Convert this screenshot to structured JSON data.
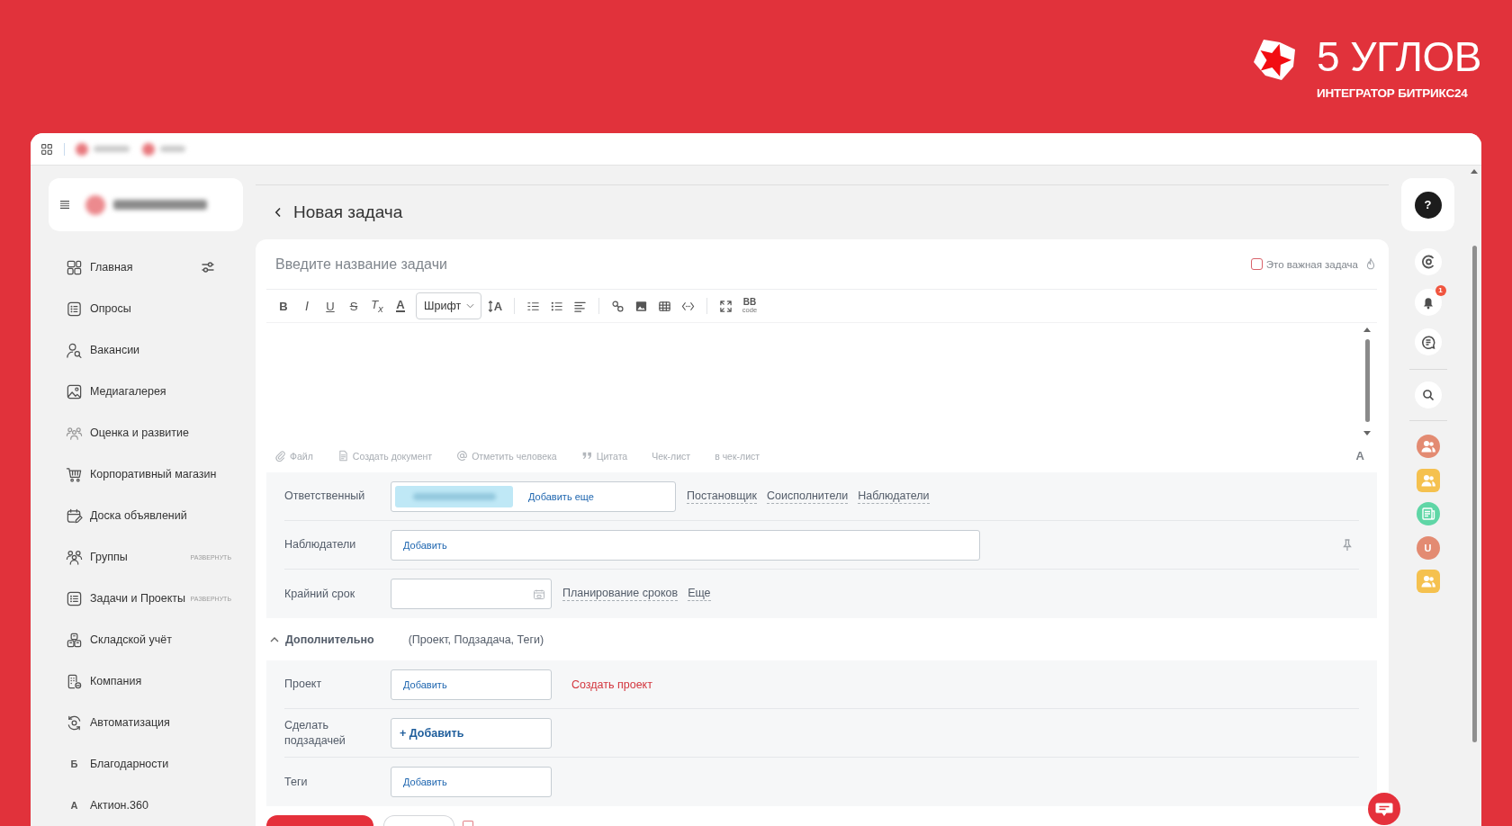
{
  "brand": {
    "name": "5 УГЛОВ",
    "tagline": "ИНТЕГРАТОР БИТРИКС24"
  },
  "sidebar": {
    "settings_icon": true,
    "items": [
      {
        "kind": "icon",
        "label": "Главная"
      },
      {
        "kind": "icon",
        "label": "Опросы"
      },
      {
        "kind": "icon",
        "label": "Вакансии"
      },
      {
        "kind": "icon",
        "label": "Медиагалерея"
      },
      {
        "kind": "icon",
        "label": "Оценка и развитие"
      },
      {
        "kind": "icon",
        "label": "Корпоративный магазин"
      },
      {
        "kind": "icon",
        "label": "Доска объявлений"
      },
      {
        "kind": "icon",
        "label": "Группы",
        "action": "РАЗВЕРНУТЬ"
      },
      {
        "kind": "icon",
        "label": "Задачи и Проекты",
        "action": "РАЗВЕРНУТЬ"
      },
      {
        "kind": "icon",
        "label": "Складской учёт"
      },
      {
        "kind": "icon",
        "label": "Компания"
      },
      {
        "kind": "icon",
        "label": "Автоматизация"
      },
      {
        "kind": "letter",
        "letter": "Б",
        "label": "Благодарности"
      },
      {
        "kind": "letter",
        "letter": "А",
        "label": "Актион.360"
      }
    ]
  },
  "page": {
    "title": "Новая задача"
  },
  "task": {
    "title_placeholder": "Введите название задачи",
    "important": {
      "label": "Это важная задача",
      "checked": false
    },
    "toolbar": [
      {
        "kind": "bold",
        "label": "B"
      },
      {
        "kind": "italic",
        "label": "I"
      },
      {
        "kind": "underline",
        "label": "U"
      },
      {
        "kind": "strike",
        "label": "S"
      },
      {
        "kind": "clear",
        "label": "T$_{x}$"
      },
      {
        "kind": "color",
        "label": "A"
      },
      {
        "kind": "font",
        "label": "Шрифт"
      },
      {
        "kind": "size",
        "label": "A"
      },
      {
        "kind": "separator"
      },
      {
        "kind": "numbered"
      },
      {
        "kind": "bullets"
      },
      {
        "kind": "align"
      },
      {
        "kind": "separator"
      },
      {
        "kind": "link"
      },
      {
        "kind": "image"
      },
      {
        "kind": "table"
      },
      {
        "kind": "code"
      },
      {
        "kind": "separator"
      },
      {
        "kind": "fullscreen"
      },
      {
        "kind": "bbcode",
        "label": "BB",
        "sublabel": "code"
      }
    ],
    "attachments": [
      {
        "kind": "file",
        "label": "Файл"
      },
      {
        "kind": "document",
        "label": "Создать документ"
      },
      {
        "kind": "mention",
        "label": "Отметить человека"
      },
      {
        "kind": "quote",
        "label": "Цитата"
      },
      {
        "kind": "plain",
        "label": "Чек-лист"
      },
      {
        "kind": "plain",
        "label": "в чек-лист"
      }
    ],
    "format_toggle": "A"
  },
  "fields": [
    {
      "kind": "people",
      "label": "Ответственный",
      "action": "Добавить еще",
      "links": [
        "Постановщик",
        "Соисполнители",
        "Наблюдатели"
      ],
      "pinned": false
    },
    {
      "kind": "wide",
      "label": "Наблюдатели",
      "action": "Добавить",
      "pinned": true
    },
    {
      "kind": "date",
      "label": "Крайний срок",
      "links": [
        "Планирование сроков",
        "Еще"
      ],
      "pinned": false
    }
  ],
  "more": {
    "label": "Дополнительно",
    "summary": "(Проект, Подзадача, Теги)",
    "expanded": true,
    "fields": [
      {
        "kind": "select",
        "label": "Проект",
        "action": "Добавить",
        "link": "Создать проект"
      },
      {
        "kind": "add",
        "label": "Сделать подзадачей",
        "action": "+ Добавить"
      },
      {
        "kind": "select",
        "label": "Теги",
        "action": "Добавить"
      }
    ]
  },
  "footer": {
    "checkbox_checked": false
  },
  "right_panel": {
    "help": "?",
    "notifications": "1",
    "avatars": [
      {
        "kind": "group",
        "color": "#e38b72"
      },
      {
        "kind": "project",
        "color": "#f5c14f"
      },
      {
        "kind": "news",
        "color": "#5fd6a6"
      },
      {
        "kind": "user",
        "label": "U",
        "color": "#e38b72"
      },
      {
        "kind": "project",
        "color": "#f5c14f"
      }
    ]
  }
}
